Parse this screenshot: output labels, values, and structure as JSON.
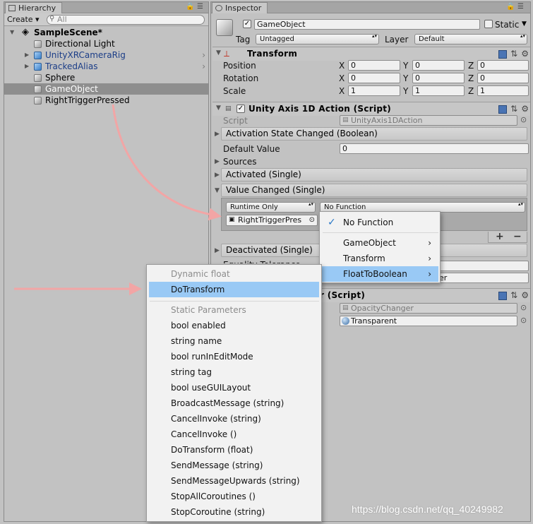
{
  "hierarchy": {
    "tab_label": "Hierarchy",
    "create_label": "Create",
    "search_placeholder": "All",
    "scene_name": "SampleScene*",
    "items": [
      {
        "label": "Directional Light",
        "prefab": false
      },
      {
        "label": "UnityXRCameraRig",
        "prefab": true
      },
      {
        "label": "TrackedAlias",
        "prefab": true
      },
      {
        "label": "Sphere",
        "prefab": false
      },
      {
        "label": "GameObject",
        "prefab": false,
        "selected": true
      },
      {
        "label": "RightTriggerPressed",
        "prefab": false
      }
    ]
  },
  "inspector": {
    "tab_label": "Inspector",
    "object_name": "GameObject",
    "static_label": "Static",
    "tag_label": "Tag",
    "tag_value": "Untagged",
    "layer_label": "Layer",
    "layer_value": "Default",
    "transform": {
      "title": "Transform",
      "rows": [
        {
          "label": "Position",
          "x": "0",
          "y": "0",
          "z": "0"
        },
        {
          "label": "Rotation",
          "x": "0",
          "y": "0",
          "z": "0"
        },
        {
          "label": "Scale",
          "x": "1",
          "y": "1",
          "z": "1"
        }
      ],
      "axis_x": "X",
      "axis_y": "Y",
      "axis_z": "Z"
    },
    "axis_action": {
      "title": "Unity Axis 1D Action (Script)",
      "script_label": "Script",
      "script_value": "UnityAxis1DAction",
      "activation_event": "Activation State Changed (Boolean)",
      "default_value_label": "Default Value",
      "default_value": "0",
      "sources_label": "Sources",
      "activated_event": "Activated (Single)",
      "value_changed_event": "Value Changed (Single)",
      "runtime_value": "Runtime Only",
      "function_value": "No Function",
      "target_object": "RightTriggerPres",
      "add_label": "+",
      "remove_label": "−",
      "deactivated_event": "Deactivated (Single)",
      "equality_label": "Equality Tolerance",
      "partial_text": "er"
    },
    "opacity": {
      "title_partial": "r (Script)",
      "script_value": "OpacityChanger",
      "material_value": "Transparent"
    }
  },
  "function_menu": {
    "items": [
      {
        "label": "No Function",
        "checked": true,
        "has_submenu": false
      },
      {
        "label": "GameObject",
        "has_submenu": true
      },
      {
        "label": "Transform",
        "has_submenu": true
      },
      {
        "label": "FloatToBoolean",
        "has_submenu": true,
        "highlighted": true
      }
    ]
  },
  "submenu": {
    "dynamic_header": "Dynamic float",
    "dynamic_items": [
      "DoTransform"
    ],
    "static_header": "Static Parameters",
    "static_items": [
      "bool enabled",
      "string name",
      "bool runInEditMode",
      "string tag",
      "bool useGUILayout",
      "BroadcastMessage (string)",
      "CancelInvoke (string)",
      "CancelInvoke ()",
      "DoTransform (float)",
      "SendMessage (string)",
      "SendMessageUpwards (string)",
      "StopAllCoroutines ()",
      "StopCoroutine (string)"
    ]
  },
  "watermark": "https://blog.csdn.net/qq_40249982",
  "colors": {
    "highlight": "#99c9f5",
    "arrow": "#f2a5a5",
    "selection": "#8e8e8e",
    "prefab_text": "#1b3d87"
  }
}
